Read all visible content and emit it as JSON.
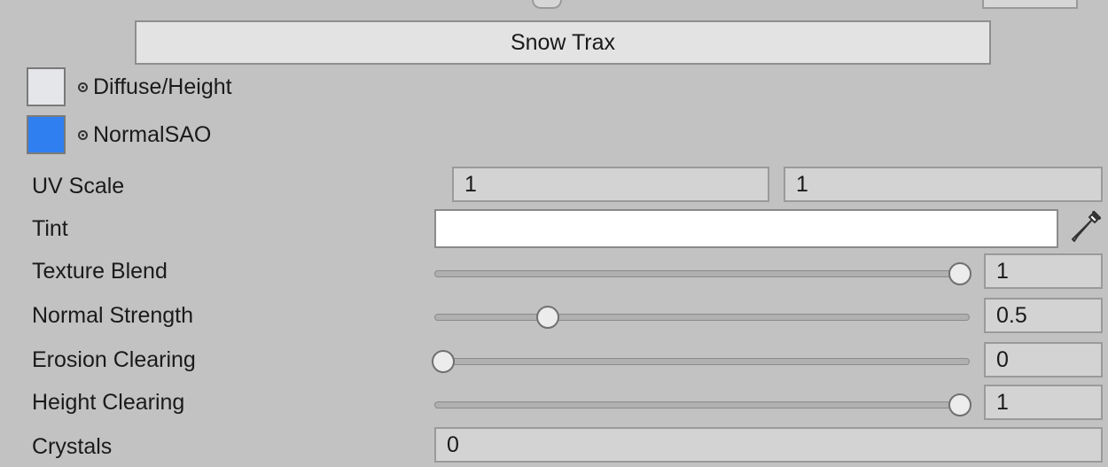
{
  "section": {
    "title": "Snow Trax"
  },
  "textures": [
    {
      "label": "Diffuse/Height",
      "swatch_color": "#e4e6ea"
    },
    {
      "label": "NormalSAO",
      "swatch_color": "#2f7ff0"
    }
  ],
  "uv_scale": {
    "label": "UV Scale",
    "x": "1",
    "y": "1"
  },
  "tint": {
    "label": "Tint",
    "color": "#ffffff"
  },
  "sliders": [
    {
      "label": "Texture Blend",
      "value": "1",
      "fraction": 1.0
    },
    {
      "label": "Normal Strength",
      "value": "0.5",
      "fraction": 0.2
    },
    {
      "label": "Erosion Clearing",
      "value": "0",
      "fraction": 0.0
    },
    {
      "label": "Height Clearing",
      "value": "1",
      "fraction": 1.0
    }
  ],
  "crystals": {
    "label": "Crystals",
    "value": "0"
  }
}
